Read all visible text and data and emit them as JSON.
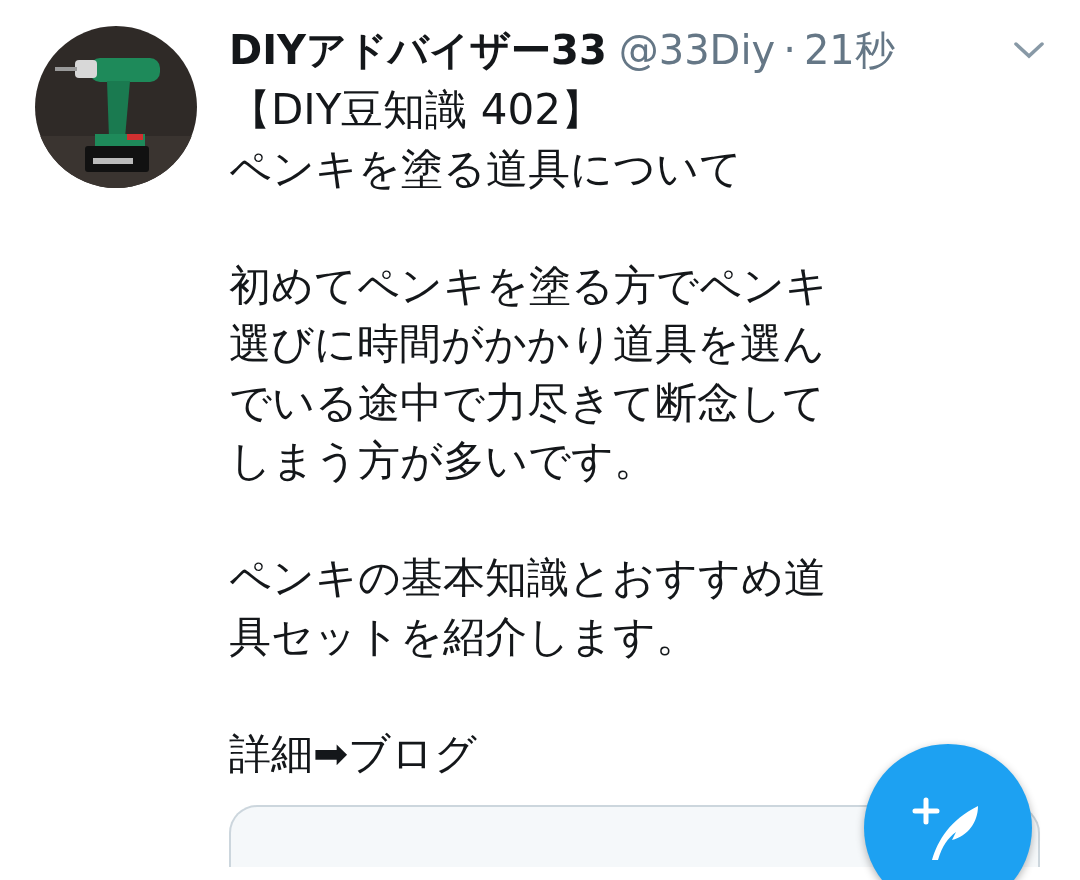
{
  "tweet": {
    "display_name": "DIYアドバイザー33",
    "handle": "@33Diy",
    "separator": "·",
    "time": "21秒",
    "title": "【DIY豆知識 402】",
    "paragraphs": [
      "ペンキを塗る道具について",
      "初めてペンキを塗る方でペンキ選びに時間がかかり道具を選んでいる途中で力尽きて断念してしまう方が多いです。",
      "ペンキの基本知識とおすすめ道具セットを紹介します。",
      "詳細➡ブログ"
    ],
    "link_card": {
      "kind": "card"
    }
  },
  "fab": {
    "kind": "compose"
  }
}
